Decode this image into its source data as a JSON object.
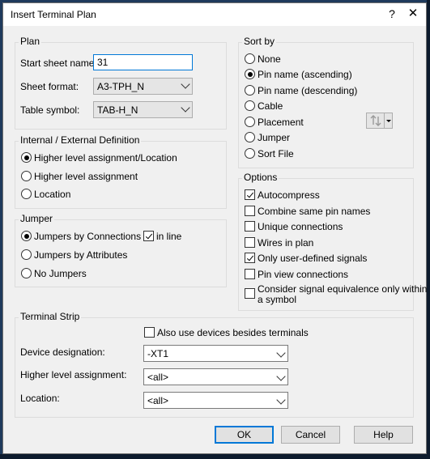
{
  "window": {
    "title": "Insert Terminal Plan",
    "help_glyph": "?",
    "close_glyph": "✕"
  },
  "plan": {
    "group_label": "Plan",
    "start_sheet_label": "Start sheet name:",
    "start_sheet_value": "31",
    "sheet_format_label": "Sheet format:",
    "sheet_format_value": "A3-TPH_N",
    "table_symbol_label": "Table symbol:",
    "table_symbol_value": "TAB-H_N"
  },
  "internal_external": {
    "group_label": "Internal / External Definition",
    "options": [
      "Higher level assignment/Location",
      "Higher level assignment",
      "Location"
    ],
    "selected": 0
  },
  "jumper": {
    "group_label": "Jumper",
    "options": [
      "Jumpers by Connections",
      "Jumpers by Attributes",
      "No Jumpers"
    ],
    "selected": 0,
    "in_line_label": "in line",
    "in_line_checked": true
  },
  "sort_by": {
    "group_label": "Sort by",
    "options": [
      "None",
      "Pin name (ascending)",
      "Pin name (descending)",
      "Cable",
      "Placement",
      "Jumper",
      "Sort File"
    ],
    "selected": 1
  },
  "options": {
    "group_label": "Options",
    "items": [
      {
        "label": "Autocompress",
        "checked": true
      },
      {
        "label": "Combine same pin names",
        "checked": false
      },
      {
        "label": "Unique connections",
        "checked": false
      },
      {
        "label": "Wires in plan",
        "checked": false
      },
      {
        "label": "Only user-defined signals",
        "checked": true
      },
      {
        "label": "Pin view connections",
        "checked": false
      },
      {
        "label": "Consider signal equivalence only within",
        "label2": "a symbol",
        "checked": false
      }
    ]
  },
  "terminal_strip": {
    "group_label": "Terminal Strip",
    "also_use_devices_label": "Also use devices besides terminals",
    "also_use_devices_checked": false,
    "device_designation_label": "Device designation:",
    "device_designation_value": "-XT1",
    "higher_level_label": "Higher level assignment:",
    "higher_level_value": "<all>",
    "location_label": "Location:",
    "location_value": "<all>"
  },
  "buttons": {
    "ok": "OK",
    "cancel": "Cancel",
    "help": "Help"
  }
}
